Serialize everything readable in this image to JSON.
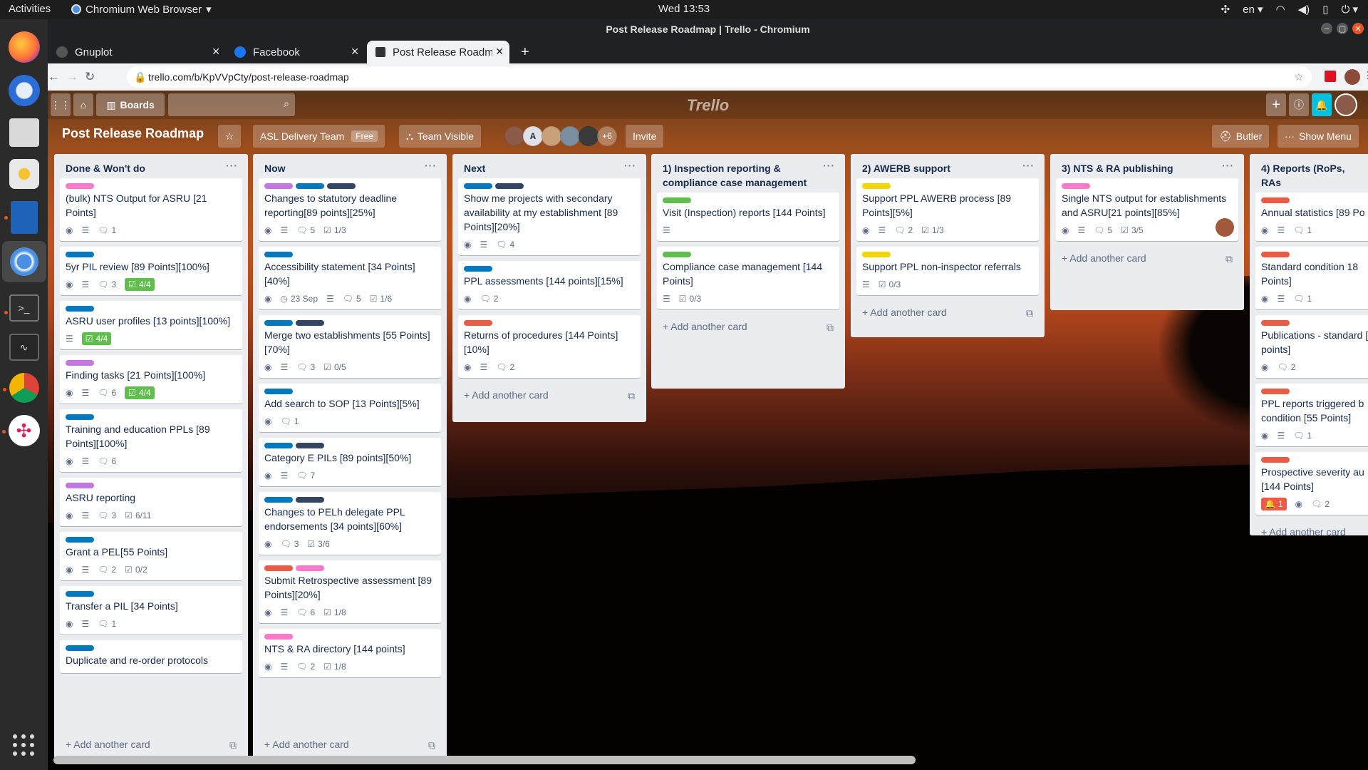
{
  "topbar": {
    "activities": "Activities",
    "app_name": "Chromium Web Browser",
    "clock": "Wed 13:53",
    "lang": "en"
  },
  "window": {
    "title": "Post Release Roadmap | Trello - Chromium"
  },
  "tabs": [
    {
      "label": "Gnuplot"
    },
    {
      "label": "Facebook"
    },
    {
      "label": "Post Release Roadmap | T"
    }
  ],
  "address": {
    "url": "trello.com/b/KpVVpCty/post-release-roadmap"
  },
  "trello": {
    "boards_label": "Boards",
    "logo": "Trello",
    "board_title": "Post Release Roadmap",
    "team": "ASL Delivery Team",
    "free": "Free",
    "visibility": "Team Visible",
    "member_initial": "A",
    "more_members": "+6",
    "invite": "Invite",
    "butler": "Butler",
    "show_menu": "Show Menu"
  },
  "colors": {
    "blue": "#0079bf",
    "pink": "#ff78cb",
    "purple": "#c377e0",
    "navy": "#344563",
    "green": "#61bd4f",
    "red": "#eb5a46",
    "yellow": "#f2d600"
  },
  "lists": [
    {
      "title": "Done & Won't do",
      "add": "Add another card",
      "cards": [
        {
          "labels": [
            "pink"
          ],
          "title": "(bulk) NTS Output for ASRU [21 Points]",
          "comments": "1"
        },
        {
          "labels": [
            "blue"
          ],
          "title": "5yr PIL review [89 Points][100%]",
          "comments": "3",
          "check": "4/4",
          "check_done": true
        },
        {
          "labels": [
            "blue"
          ],
          "title": "ASRU user profiles [13 points][100%]",
          "check": "4/4",
          "check_done": true,
          "no_watch": true
        },
        {
          "labels": [
            "purple"
          ],
          "title": "Finding tasks [21 Points][100%]",
          "comments": "6",
          "check": "4/4",
          "check_done": true
        },
        {
          "labels": [
            "blue"
          ],
          "title": "Training and education PPLs [89 Points][100%]",
          "comments": "6"
        },
        {
          "labels": [
            "purple"
          ],
          "title": "ASRU reporting",
          "comments": "3",
          "check": "6/11"
        },
        {
          "labels": [
            "blue"
          ],
          "title": "Grant a PEL[55 Points]",
          "comments": "2",
          "check": "0/2"
        },
        {
          "labels": [
            "blue"
          ],
          "title": "Transfer a PIL [34 Points]",
          "comments": "1"
        },
        {
          "labels": [
            "blue"
          ],
          "title": "Duplicate and re-order protocols",
          "no_badges": true
        }
      ]
    },
    {
      "title": "Now",
      "add": "Add another card",
      "cards": [
        {
          "labels": [
            "purple",
            "blue",
            "navy"
          ],
          "title": "Changes to statutory deadline reporting[89 points][25%]",
          "comments": "5",
          "check": "1/3"
        },
        {
          "labels": [
            "blue"
          ],
          "title": "Accessibility statement [34 Points][40%]",
          "due": "23 Sep",
          "comments": "5",
          "check": "1/6"
        },
        {
          "labels": [
            "blue",
            "navy"
          ],
          "title": "Merge two establishments [55 Points][70%]",
          "comments": "3",
          "check": "0/5"
        },
        {
          "labels": [
            "blue"
          ],
          "title": "Add search to SOP [13 Points][5%]",
          "comments": "1",
          "no_desc": true
        },
        {
          "labels": [
            "blue",
            "navy"
          ],
          "title": "Category E PILs [89 points][50%]",
          "comments": "7"
        },
        {
          "labels": [
            "blue",
            "navy"
          ],
          "title": "Changes to PELh delegate PPL endorsements [34 points][60%]",
          "comments": "3",
          "check": "3/6",
          "no_desc": true
        },
        {
          "labels": [
            "red",
            "pink"
          ],
          "title": "Submit Retrospective assessment [89 Points][20%]",
          "comments": "6",
          "check": "1/8"
        },
        {
          "labels": [
            "pink"
          ],
          "title": "NTS & RA directory [144 points]",
          "comments": "2",
          "check": "1/8"
        }
      ]
    },
    {
      "title": "Next",
      "add": "Add another card",
      "cards": [
        {
          "labels": [
            "blue",
            "navy"
          ],
          "title": "Show me projects with secondary availability at my establishment [89 Points][20%]",
          "comments": "4"
        },
        {
          "labels": [
            "blue"
          ],
          "title": "PPL assessments [144 points][15%]",
          "comments": "2",
          "no_desc": true
        },
        {
          "labels": [
            "red"
          ],
          "title": "Returns of procedures [144 Points][10%]",
          "comments": "2"
        }
      ]
    },
    {
      "title": "1) Inspection reporting & compliance case management",
      "add": "Add another card",
      "cards": [
        {
          "labels": [
            "green"
          ],
          "title": "Visit (Inspection) reports [144 Points]",
          "no_watch": true,
          "desc_only": true
        },
        {
          "labels": [
            "green"
          ],
          "title": "Compliance case management [144 Points]",
          "check": "0/3",
          "no_watch": true
        }
      ]
    },
    {
      "title": "2) AWERB support",
      "add": "Add another card",
      "cards": [
        {
          "labels": [
            "yellow"
          ],
          "title": "Support PPL AWERB process [89 Points][5%]",
          "comments": "2",
          "check": "1/3"
        },
        {
          "labels": [
            "yellow"
          ],
          "title": "Support PPL non-inspector referrals",
          "check": "0/3",
          "no_watch": true
        }
      ]
    },
    {
      "title": "3) NTS & RA publishing",
      "add": "Add another card",
      "cards": [
        {
          "labels": [
            "pink"
          ],
          "title": "Single NTS output for establishments and ASRU[21 points][85%]",
          "comments": "5",
          "check": "3/5",
          "avatar": true
        }
      ]
    },
    {
      "title": "4) Reports (RoPs, RAs",
      "add": "Add another card",
      "cards": [
        {
          "labels": [
            "red"
          ],
          "title": "Annual statistics [89 Po",
          "comments": "1"
        },
        {
          "labels": [
            "red"
          ],
          "title": "Standard condition 18 Points]",
          "comments": "1"
        },
        {
          "labels": [
            "red"
          ],
          "title": "Publications - standard [55 points]",
          "comments": "2",
          "no_desc": true
        },
        {
          "labels": [
            "red"
          ],
          "title": "PPL reports triggered b condition [55 Points]",
          "comments": "1"
        },
        {
          "labels": [
            "red"
          ],
          "title": "Prospective severity au [144 Points]",
          "alert": "1",
          "comments": "2",
          "no_desc": true
        }
      ]
    }
  ]
}
